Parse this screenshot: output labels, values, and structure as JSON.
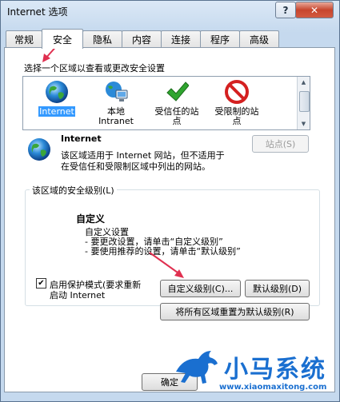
{
  "window": {
    "title": "Internet 选项",
    "help_label": "?",
    "close_label": "✕"
  },
  "tabs": [
    "常规",
    "安全",
    "隐私",
    "内容",
    "连接",
    "程序",
    "高级"
  ],
  "zones": {
    "prompt": "选择一个区域以查看或更改安全设置",
    "items": [
      {
        "label": "Internet",
        "icon": "globe-icon"
      },
      {
        "label": "本地\nIntranet",
        "icon": "intranet-icon"
      },
      {
        "label": "受信任的站\n点",
        "icon": "checkmark-icon"
      },
      {
        "label": "受限制的站\n点",
        "icon": "restricted-icon"
      }
    ]
  },
  "selected_zone": {
    "name": "Internet",
    "description_line1": "该区域适用于 Internet 网站，但不适用于",
    "description_line2": "在受信任和受限制区域中列出的网站。",
    "sites_button": "站点(S)"
  },
  "security_level": {
    "group_title": "该区域的安全级别(L)",
    "level_name": "自定义",
    "line1": "自定义设置",
    "line2": "- 要更改设置，请单击“自定义级别”",
    "line3": "- 要使用推荐的设置，请单击“默认级别”",
    "protected_mode_line1": "启用保护模式(要求重新",
    "protected_mode_line2": "启动 Internet",
    "protected_mode_checked": true,
    "custom_level_button": "自定义级别(C)...",
    "default_level_button": "默认级别(D)",
    "reset_all_button": "将所有区域重置为默认级别(R)"
  },
  "footer": {
    "ok_button": "确定"
  },
  "watermark": {
    "brand": "小马系统",
    "url": "www.xiaomaxitong.com"
  },
  "colors": {
    "accent": "#3399ff",
    "annotation_arrow": "#e03050",
    "brand_blue": "#1a6fd0"
  }
}
